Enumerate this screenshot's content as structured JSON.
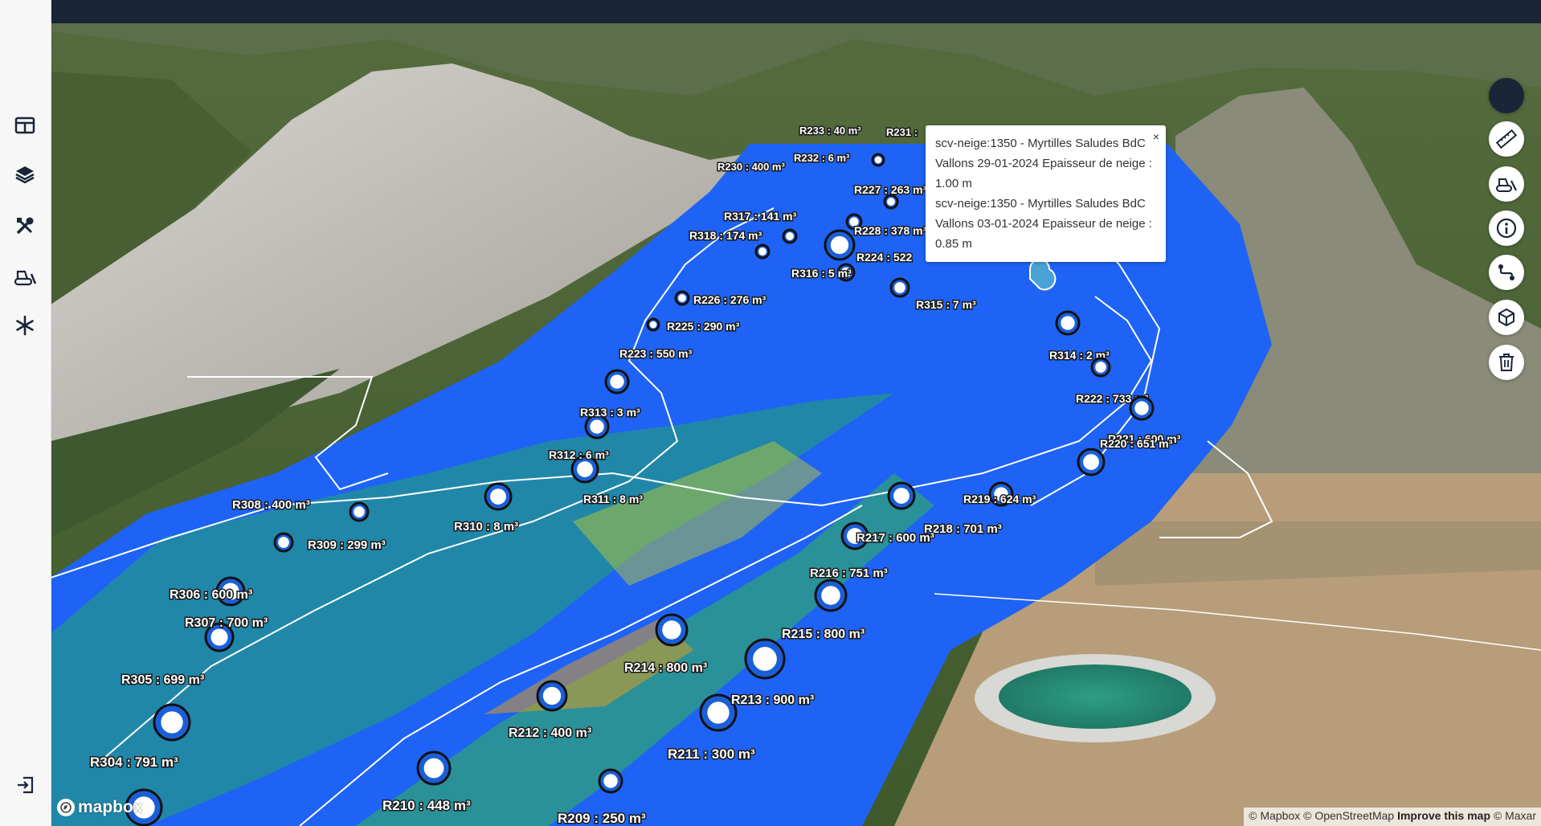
{
  "sidebar": {
    "items": [
      {
        "name": "layout-icon"
      },
      {
        "name": "layers-icon"
      },
      {
        "name": "tools-icon"
      },
      {
        "name": "snowcat-icon"
      },
      {
        "name": "snowflake-icon"
      }
    ],
    "logout": {
      "name": "logout-icon"
    }
  },
  "popup": {
    "lines": [
      "scv-neige:1350 - Myrtilles Saludes BdC",
      "Vallons 29-01-2024 Epaisseur de neige :",
      "1.00 m",
      "scv-neige:1350 - Myrtilles Saludes BdC",
      "Vallons 03-01-2024 Epaisseur de neige :",
      "0.85 m"
    ],
    "close_label": "×"
  },
  "controls": [
    {
      "name": "account-icon"
    },
    {
      "name": "ruler-icon"
    },
    {
      "name": "snow-groomer-icon"
    },
    {
      "name": "info-icon"
    },
    {
      "name": "route-icon"
    },
    {
      "name": "cube-3d-icon"
    },
    {
      "name": "trash-icon"
    }
  ],
  "markers": [
    "R233 : 40 m³",
    "R231 :",
    "R232 : 6 m³",
    "R230 : 400 m³",
    "R227 : 263 m³",
    "R317 : 141 m³",
    "R228 : 378 m³",
    "R318 : 174 m³",
    "R224 : 522",
    "R226 : 276 m³",
    "R316 : 5 m³",
    "R225 : 290 m³",
    "R315 : 7 m³",
    "R223 : 550 m³",
    "R314 : 2 m³",
    "R222 : 733 m³",
    "R221 : 600 m³",
    "R313 : 3 m³",
    "R220 : 651 m³",
    "R312 : 6 m³",
    "R219 : 624 m³",
    "R311 : 8 m³",
    "R308 : 400 m³",
    "R310 : 8 m³",
    "R218 : 701 m³",
    "R217 : 600 m³",
    "R309 : 299 m³",
    "R216 : 751 m³",
    "R306 : 600 m³",
    "R307 : 700 m³",
    "R215 : 800 m³",
    "R305 : 699 m³",
    "R214 : 800 m³",
    "R213 : 900 m³",
    "R212 : 400 m³",
    "R304 : 791 m³",
    "R211 : 300 m³",
    "R210 : 448 m³",
    "R209 : 250 m³"
  ],
  "logo": {
    "text": "mapbox"
  },
  "attribution": {
    "mapbox": "© Mapbox",
    "osm": "© OpenStreetMap",
    "improve": "Improve this map",
    "maxar": "© Maxar"
  },
  "colors": {
    "sidebar_bg": "#f7f7f8",
    "topbar": "#1a2538",
    "snow_heatmap_base": "#1e63f5",
    "label_text": "#ffffff"
  }
}
